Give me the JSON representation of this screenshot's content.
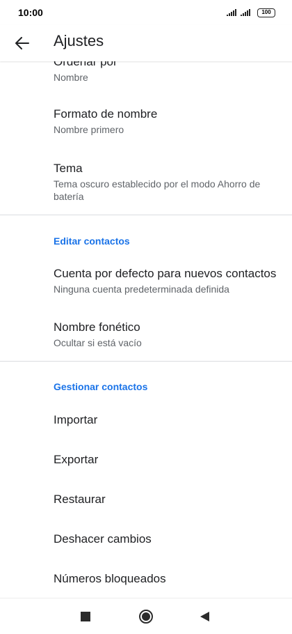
{
  "status_bar": {
    "time": "10:00",
    "battery": "100"
  },
  "app_bar": {
    "title": "Ajustes",
    "back_icon": "arrow-back-icon"
  },
  "settings": {
    "order_by": {
      "title": "Ordenar por",
      "subtitle": "Nombre"
    },
    "name_format": {
      "title": "Formato de nombre",
      "subtitle": "Nombre primero"
    },
    "theme": {
      "title": "Tema",
      "subtitle": "Tema oscuro establecido por el modo Ahorro de batería"
    },
    "edit_section": {
      "header": "Editar contactos"
    },
    "default_account": {
      "title": "Cuenta por defecto para nuevos contactos",
      "subtitle": "Ninguna cuenta predeterminada definida"
    },
    "phonetic_name": {
      "title": "Nombre fonético",
      "subtitle": "Ocultar si está vacío"
    },
    "manage_section": {
      "header": "Gestionar contactos"
    },
    "import": "Importar",
    "export": "Exportar",
    "restore": "Restaurar",
    "undo_changes": "Deshacer cambios",
    "blocked_numbers": "Números bloqueados"
  },
  "colors": {
    "accent": "#1a73e8",
    "text_primary": "#202124",
    "text_secondary": "#5f6368"
  }
}
